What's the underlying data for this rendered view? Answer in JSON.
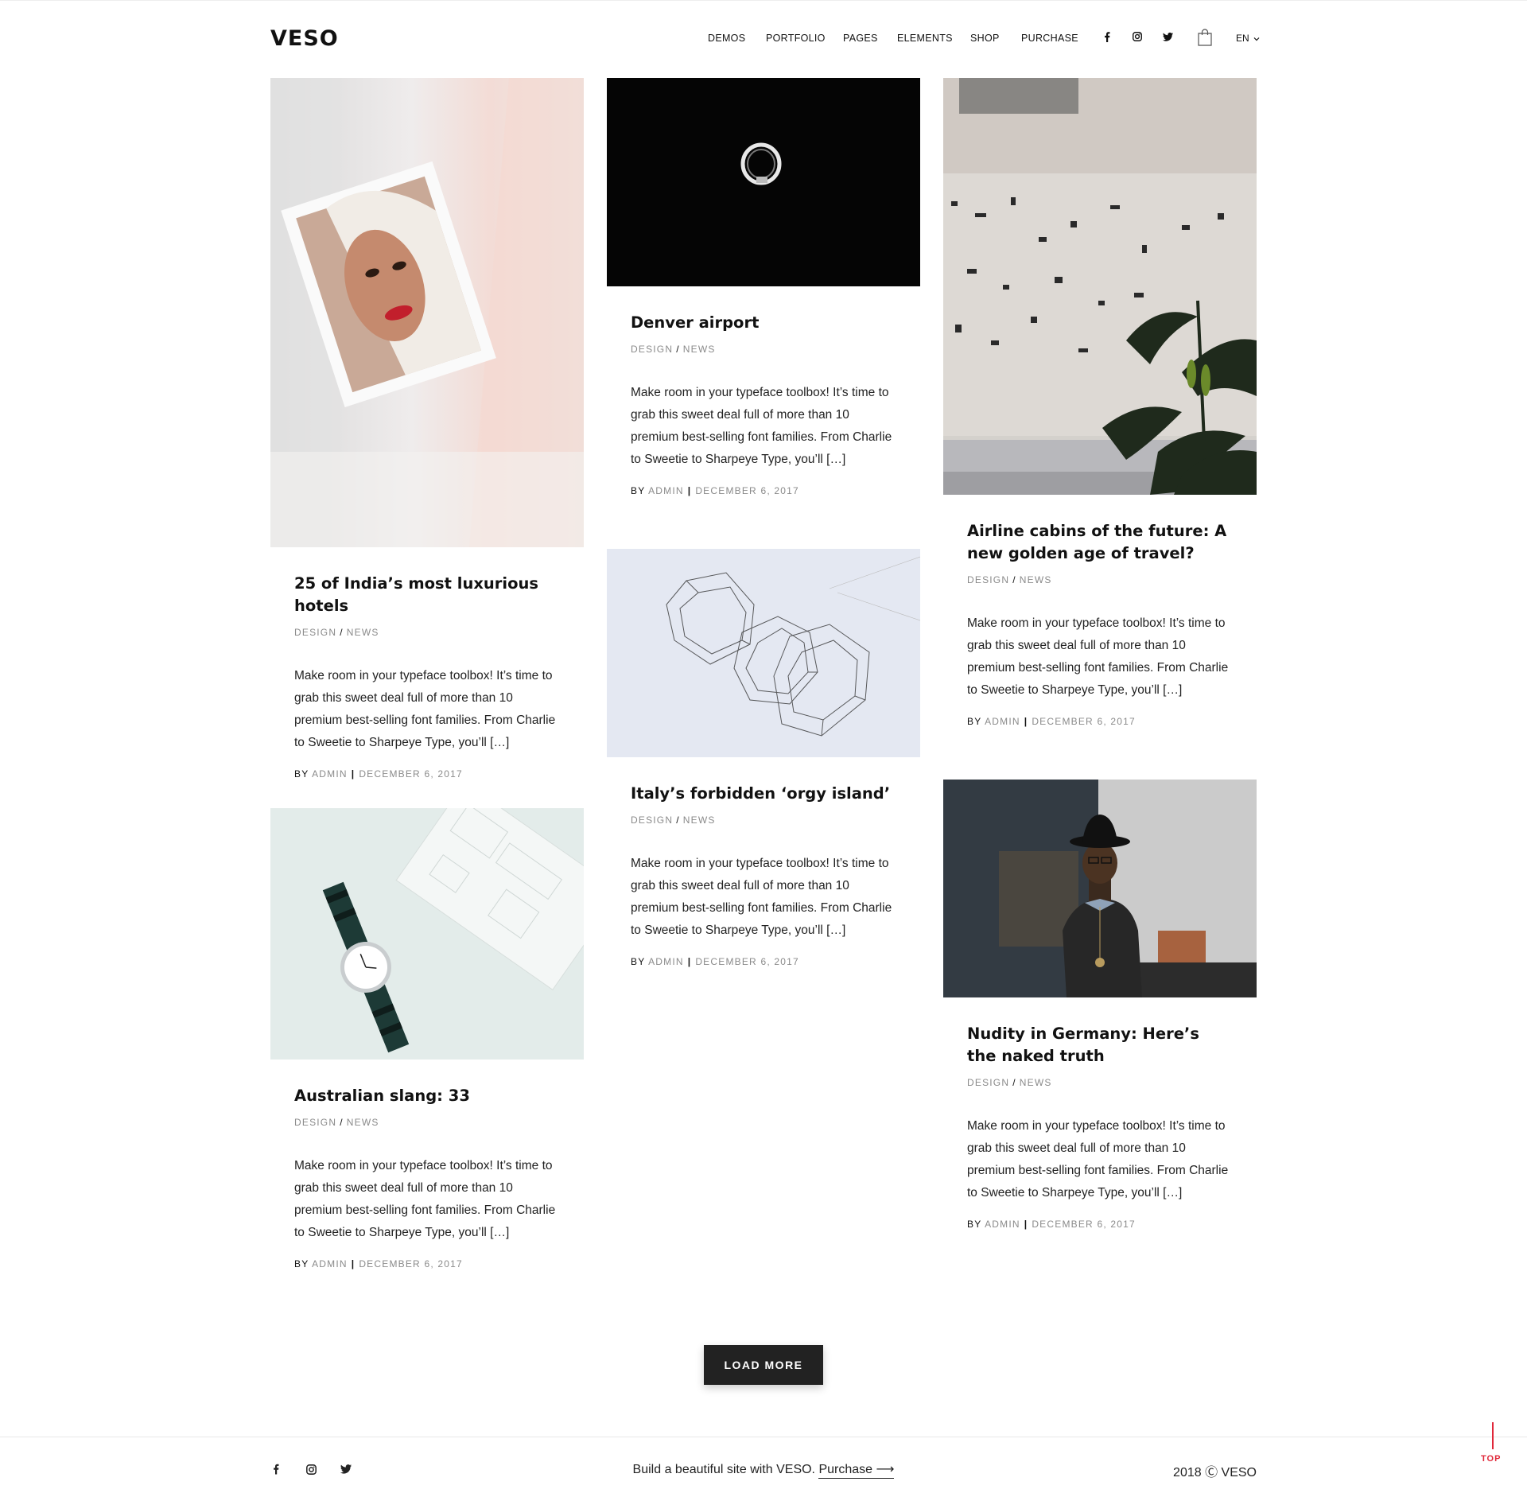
{
  "brand": {
    "logo": "VESO"
  },
  "nav": {
    "items": [
      "DEMOS",
      "PORTFOLIO",
      "PAGES",
      "ELEMENTS",
      "SHOP",
      "PURCHASE"
    ],
    "icons": [
      "facebook-icon",
      "instagram-icon",
      "twitter-icon"
    ],
    "cart_icon": "shopping-bag-icon",
    "language": "EN"
  },
  "posts": [
    {
      "title": "25 of India’s most luxurious hotels",
      "cat1": "DESIGN",
      "cat2": "NEWS",
      "excerpt": "Make room in your typeface toolbox! It’s time to grab this sweet deal full of more than 10 premium best-selling font families. From Charlie to Sweetie to Sharpeye Type, you’ll […]",
      "by": "BY",
      "author": "ADMIN",
      "date": "DECEMBER 6, 2017"
    },
    {
      "title": "Denver airport",
      "cat1": "DESIGN",
      "cat2": "NEWS",
      "excerpt": "Make room in your typeface toolbox! It’s time to grab this sweet deal full of more than 10 premium best-selling font families. From Charlie to Sweetie to Sharpeye Type, you’ll […]",
      "by": "BY",
      "author": "ADMIN",
      "date": "DECEMBER 6, 2017"
    },
    {
      "title": "Airline cabins of the future: A new golden age of travel?",
      "cat1": "DESIGN",
      "cat2": "NEWS",
      "excerpt": "Make room in your typeface toolbox! It’s time to grab this sweet deal full of more than 10 premium best-selling font families. From Charlie to Sweetie to Sharpeye Type, you’ll […]",
      "by": "BY",
      "author": "ADMIN",
      "date": "DECEMBER 6, 2017"
    },
    {
      "title": "Italy’s forbidden ‘orgy island’",
      "cat1": "DESIGN",
      "cat2": "NEWS",
      "excerpt": "Make room in your typeface toolbox! It’s time to grab this sweet deal full of more than 10 premium best-selling font families. From Charlie to Sweetie to Sharpeye Type, you’ll […]",
      "by": "BY",
      "author": "ADMIN",
      "date": "DECEMBER 6, 2017"
    },
    {
      "title": "Australian slang: 33",
      "cat1": "DESIGN",
      "cat2": "NEWS",
      "excerpt": "Make room in your typeface toolbox! It’s time to grab this sweet deal full of more than 10 premium best-selling font families. From Charlie to Sweetie to Sharpeye Type, you’ll […]",
      "by": "BY",
      "author": "ADMIN",
      "date": "DECEMBER 6, 2017"
    },
    {
      "title": "Nudity in Germany: Here’s the naked truth",
      "cat1": "DESIGN",
      "cat2": "NEWS",
      "excerpt": "Make room in your typeface toolbox! It’s time to grab this sweet deal full of more than 10 premium best-selling font families. From Charlie to Sweetie to Sharpeye Type, you’ll […]",
      "by": "BY",
      "author": "ADMIN",
      "date": "DECEMBER 6, 2017"
    }
  ],
  "load_more": "LOAD MORE",
  "footer": {
    "icons": [
      "facebook-icon",
      "instagram-icon",
      "twitter-icon"
    ],
    "tagline": "Build a beautiful site with VESO.",
    "purchase_link": "Purchase ⟶",
    "copyright": "2018 Ⓒ VESO",
    "top_label": "TOP"
  },
  "colors": {
    "accent": "#e0283a",
    "dark": "#222222",
    "muted": "#8a8a8a"
  }
}
